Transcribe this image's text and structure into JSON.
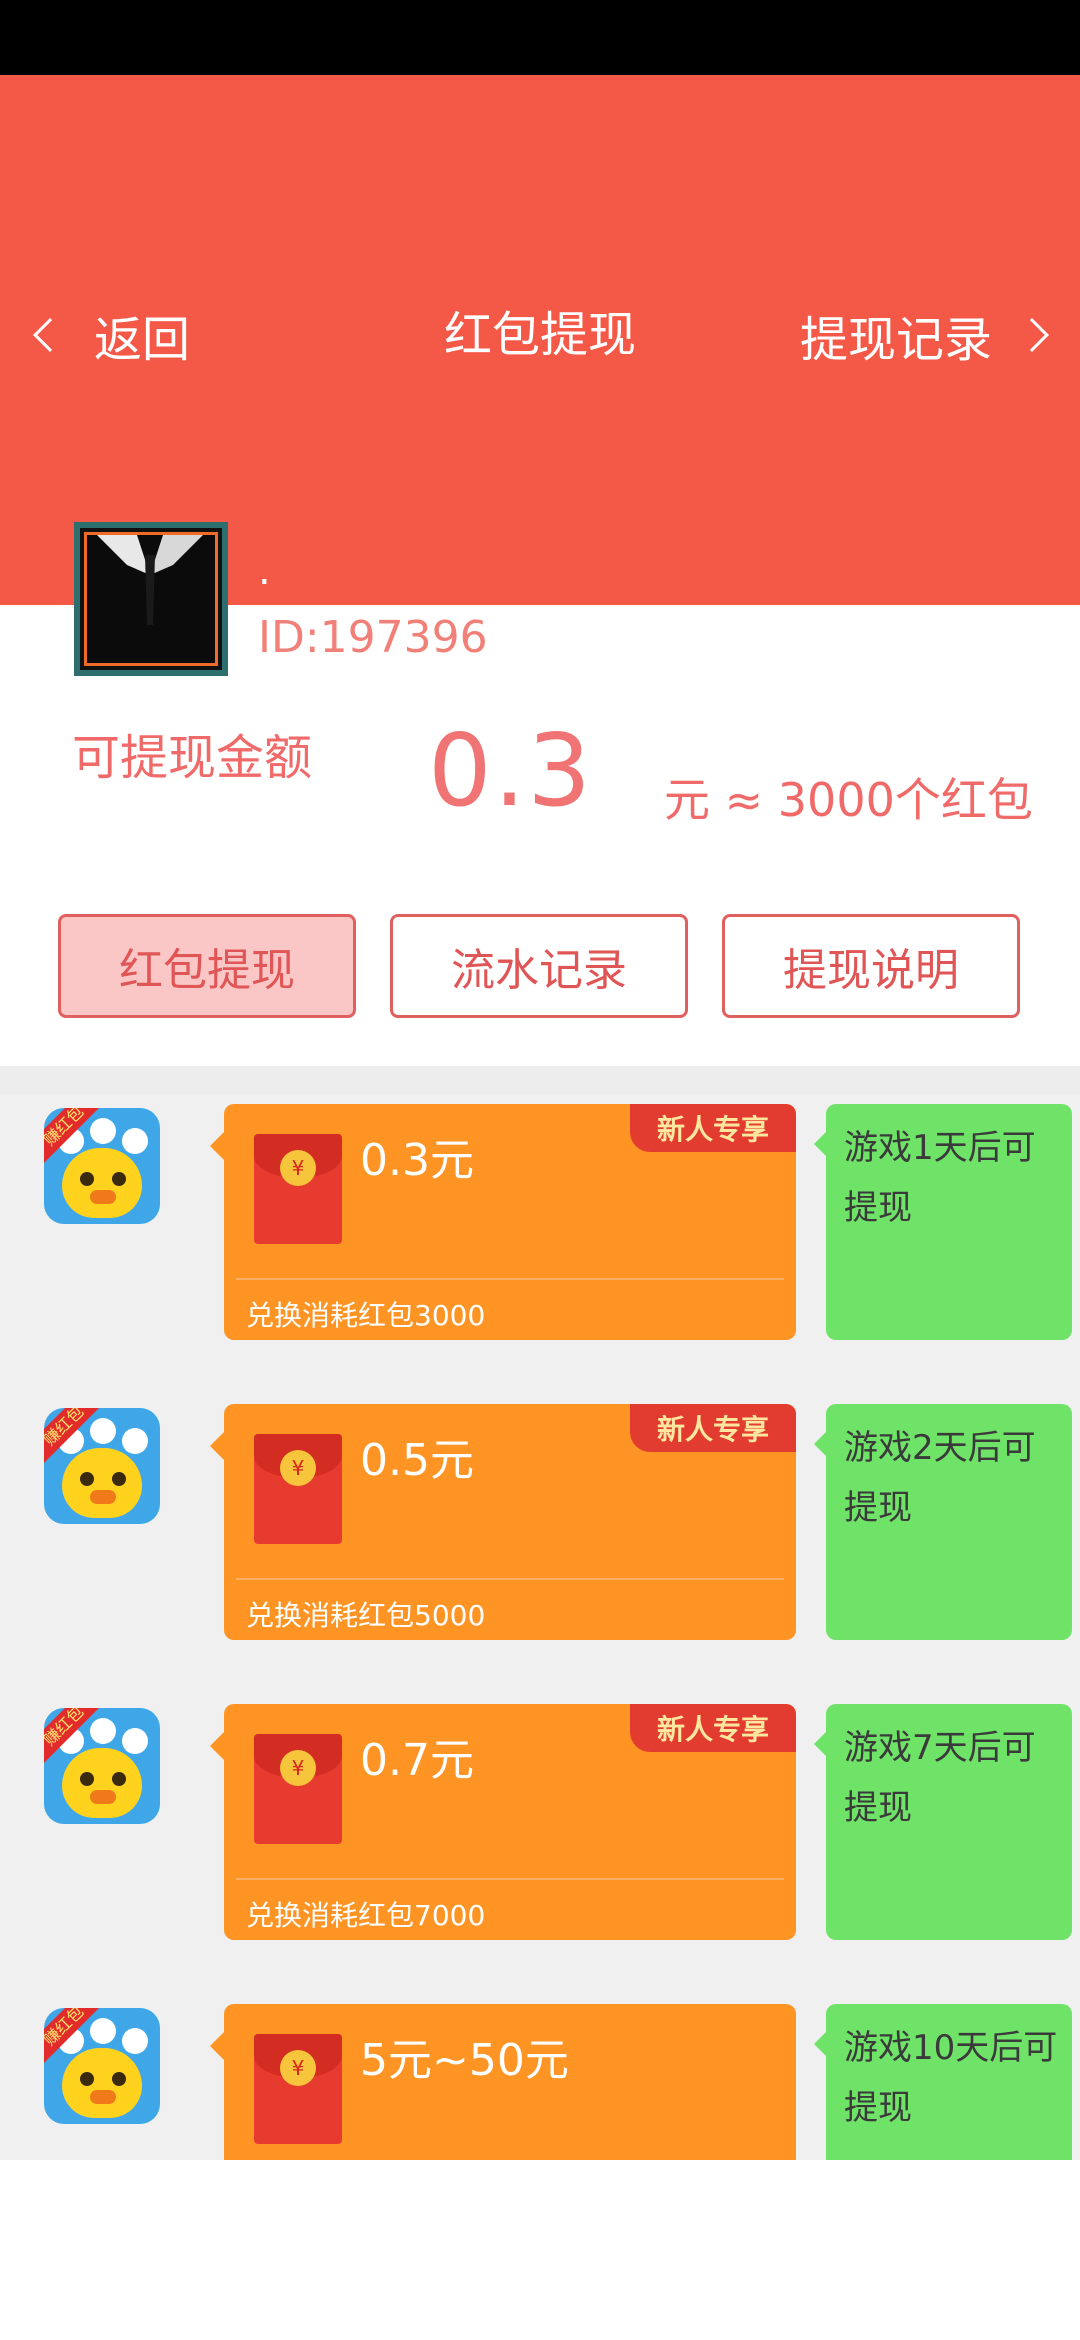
{
  "header": {
    "back_label": "返回",
    "title": "红包提现",
    "records_label": "提现记录",
    "background_color": "#F45846"
  },
  "user": {
    "nickname": ".",
    "id_text": "ID:197396"
  },
  "balance": {
    "label": "可提现金额",
    "amount": "0.3",
    "equivalent": "元 ≈ 3000个红包"
  },
  "tabs": [
    {
      "label": "红包提现",
      "active": true
    },
    {
      "label": "流水记录",
      "active": false
    },
    {
      "label": "提现说明",
      "active": false
    }
  ],
  "rewards": [
    {
      "amount": "0.3元",
      "badge": "新人专享",
      "cost": "兑换消耗红包3000",
      "note": "游戏1天后可提现",
      "coin": "¥",
      "icon_ribbon": "赚红包"
    },
    {
      "amount": "0.5元",
      "badge": "新人专享",
      "cost": "兑换消耗红包5000",
      "note": "游戏2天后可提现",
      "coin": "¥",
      "icon_ribbon": "赚红包"
    },
    {
      "amount": "0.7元",
      "badge": "新人专享",
      "cost": "兑换消耗红包7000",
      "note": "游戏7天后可提现",
      "coin": "¥",
      "icon_ribbon": "赚红包"
    },
    {
      "amount": "5元~50元",
      "badge": "",
      "cost": "",
      "note": "游戏10天后可提现",
      "coin": "¥",
      "icon_ribbon": "赚红包"
    }
  ],
  "colors": {
    "card_orange": "#FE9424",
    "note_green": "#6FE368",
    "badge_red": "#E23B30",
    "tab_border": "#E06060",
    "tab_active_bg": "#FBC6C6"
  }
}
